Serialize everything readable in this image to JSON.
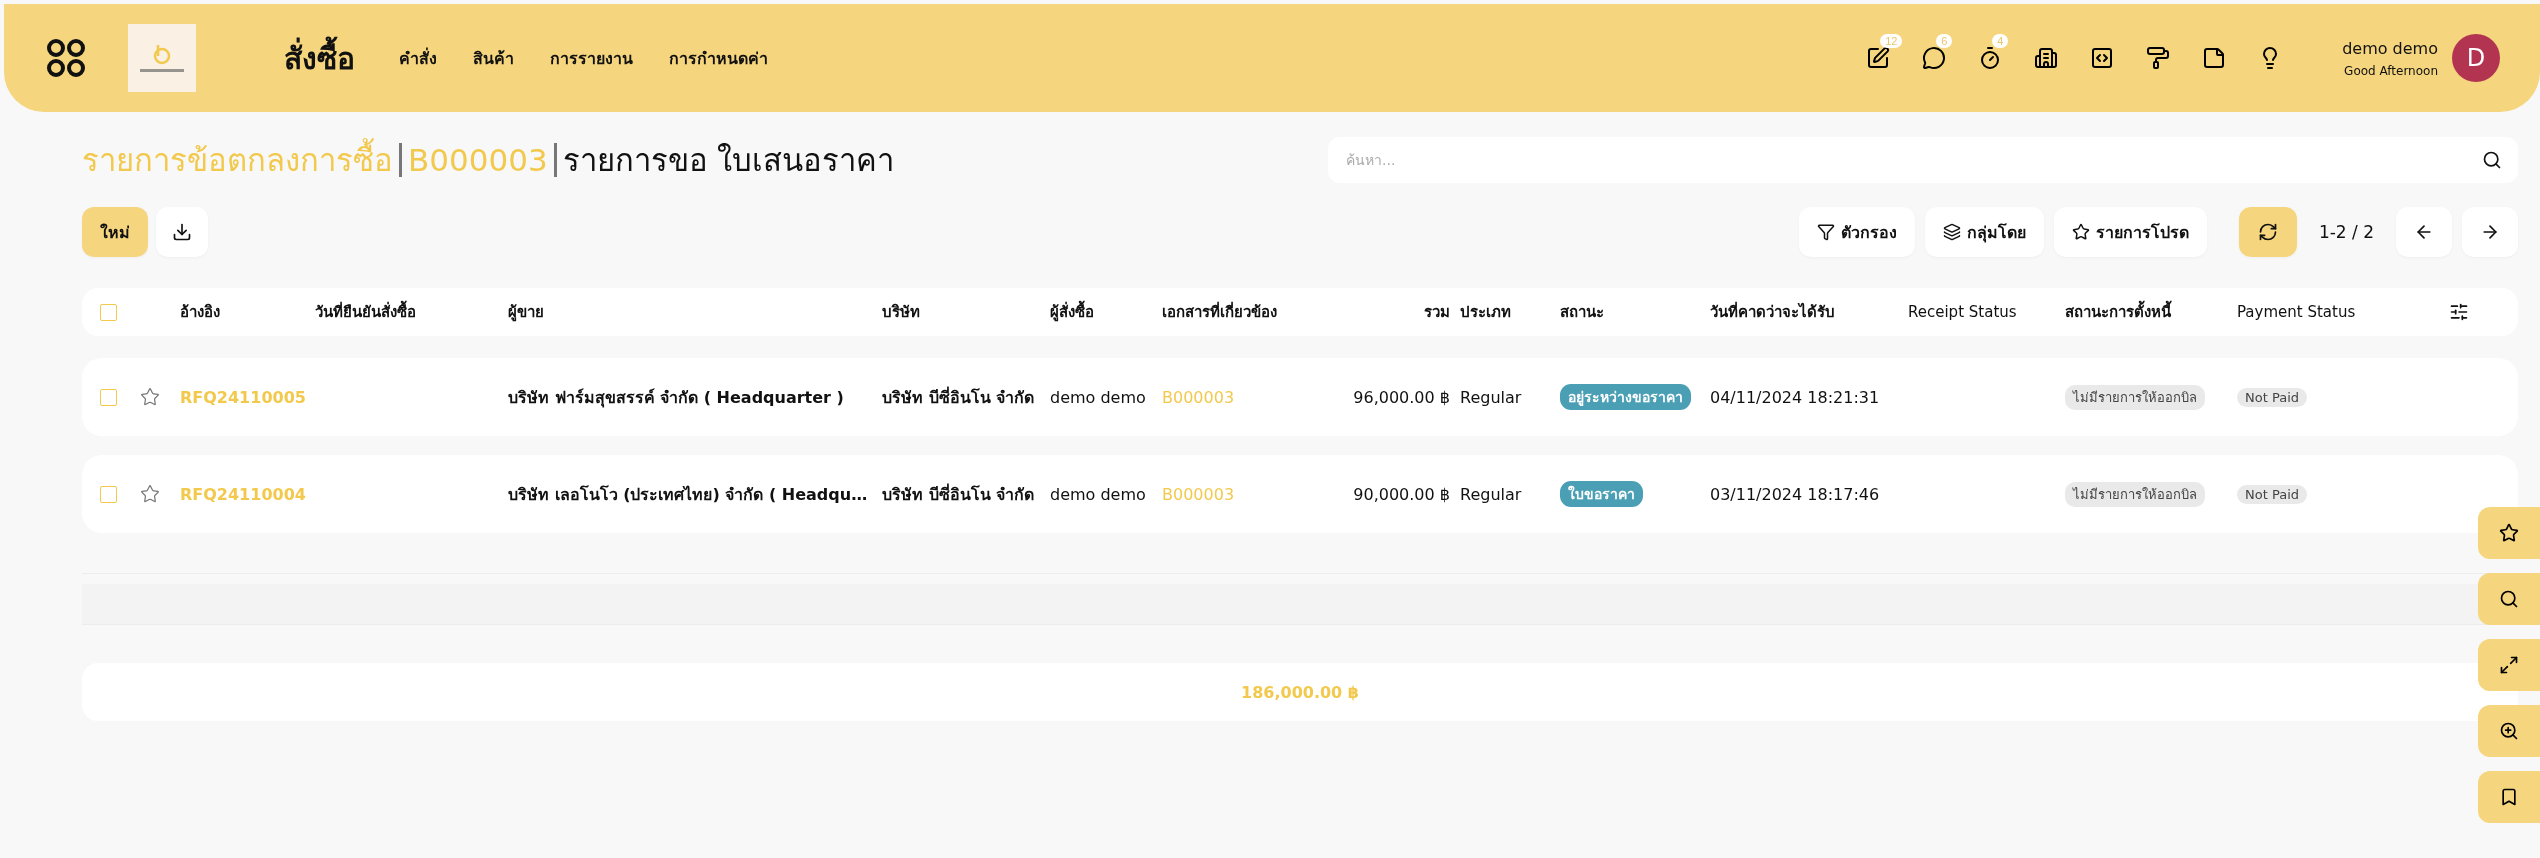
{
  "header": {
    "app_title": "สั่งซื้อ",
    "menu": [
      {
        "label": "คำสั่ง"
      },
      {
        "label": "สินค้า"
      },
      {
        "label": "การรายงาน"
      },
      {
        "label": "การกำหนดค่า"
      }
    ],
    "tools": [
      {
        "kind": "edit",
        "badge": "12"
      },
      {
        "kind": "chat",
        "badge": "6"
      },
      {
        "kind": "timer",
        "badge": "4"
      },
      {
        "kind": "building"
      },
      {
        "kind": "code"
      },
      {
        "kind": "paint"
      },
      {
        "kind": "note"
      },
      {
        "kind": "idea"
      }
    ],
    "user": {
      "name": "demo demo",
      "greeting": "Good Afternoon",
      "initial": "D"
    }
  },
  "breadcrumb": [
    {
      "text": "รายการข้อตกลงการซื้อ",
      "kind": "link"
    },
    {
      "text": "B000003",
      "kind": "link"
    },
    {
      "text": "รายการขอ ใบเสนอราคา",
      "kind": "current"
    }
  ],
  "search": {
    "placeholder": "ค้นหา..."
  },
  "new_button": "ใหม่",
  "filters": [
    {
      "kind": "filter",
      "label": "ตัวกรอง"
    },
    {
      "kind": "group",
      "label": "กลุ่มโดย"
    },
    {
      "kind": "favorites",
      "label": "รายการโปรด"
    }
  ],
  "pager": "1-2 / 2",
  "table": {
    "select_all": false,
    "columns": [
      "อ้างอิง",
      "วันที่ยืนยันสั่งซื้อ",
      "ผู้ขาย",
      "บริษัท",
      "ผู้สั่งซื้อ",
      "เอกสารที่เกี่ยวข้อง",
      "รวม",
      "ประเภท",
      "สถานะ",
      "วันที่คาดว่าจะได้รับ",
      "Receipt Status",
      "สถานะการตั้งหนี้",
      "Payment Status"
    ],
    "rows": [
      {
        "checked": false,
        "starred": false,
        "reference": "RFQ24110005",
        "vendor": "บริษัท ฟาร์มสุขสรรค์ จำกัด ( Headquarter )",
        "company": "บริษัท บีซี่อินโน จำกัด",
        "buyer": "demo demo",
        "source": "B000003",
        "total": "96,000.00 ฿",
        "type": "Regular",
        "status": "อยู่ระหว่างขอราคา",
        "expected": "04/11/2024 18:21:31",
        "billing": "ไม่มีรายการให้ออกบิล",
        "payment": "Not Paid"
      },
      {
        "checked": false,
        "starred": false,
        "reference": "RFQ24110004",
        "vendor": "บริษัท เลอโนโว (ประเทศไทย) จำกัด ( Headqu…",
        "company": "บริษัท บีซี่อินโน จำกัด",
        "buyer": "demo demo",
        "source": "B000003",
        "total": "90,000.00 ฿",
        "type": "Regular",
        "status": "ใบขอราคา",
        "expected": "03/11/2024 18:17:46",
        "billing": "ไม่มีรายการให้ออกบิล",
        "payment": "Not Paid"
      }
    ],
    "grand_total": "186,000.00 ฿"
  },
  "side_buttons": [
    {
      "kind": "star"
    },
    {
      "kind": "search"
    },
    {
      "kind": "expand"
    },
    {
      "kind": "zoom"
    },
    {
      "kind": "bookmark"
    }
  ]
}
